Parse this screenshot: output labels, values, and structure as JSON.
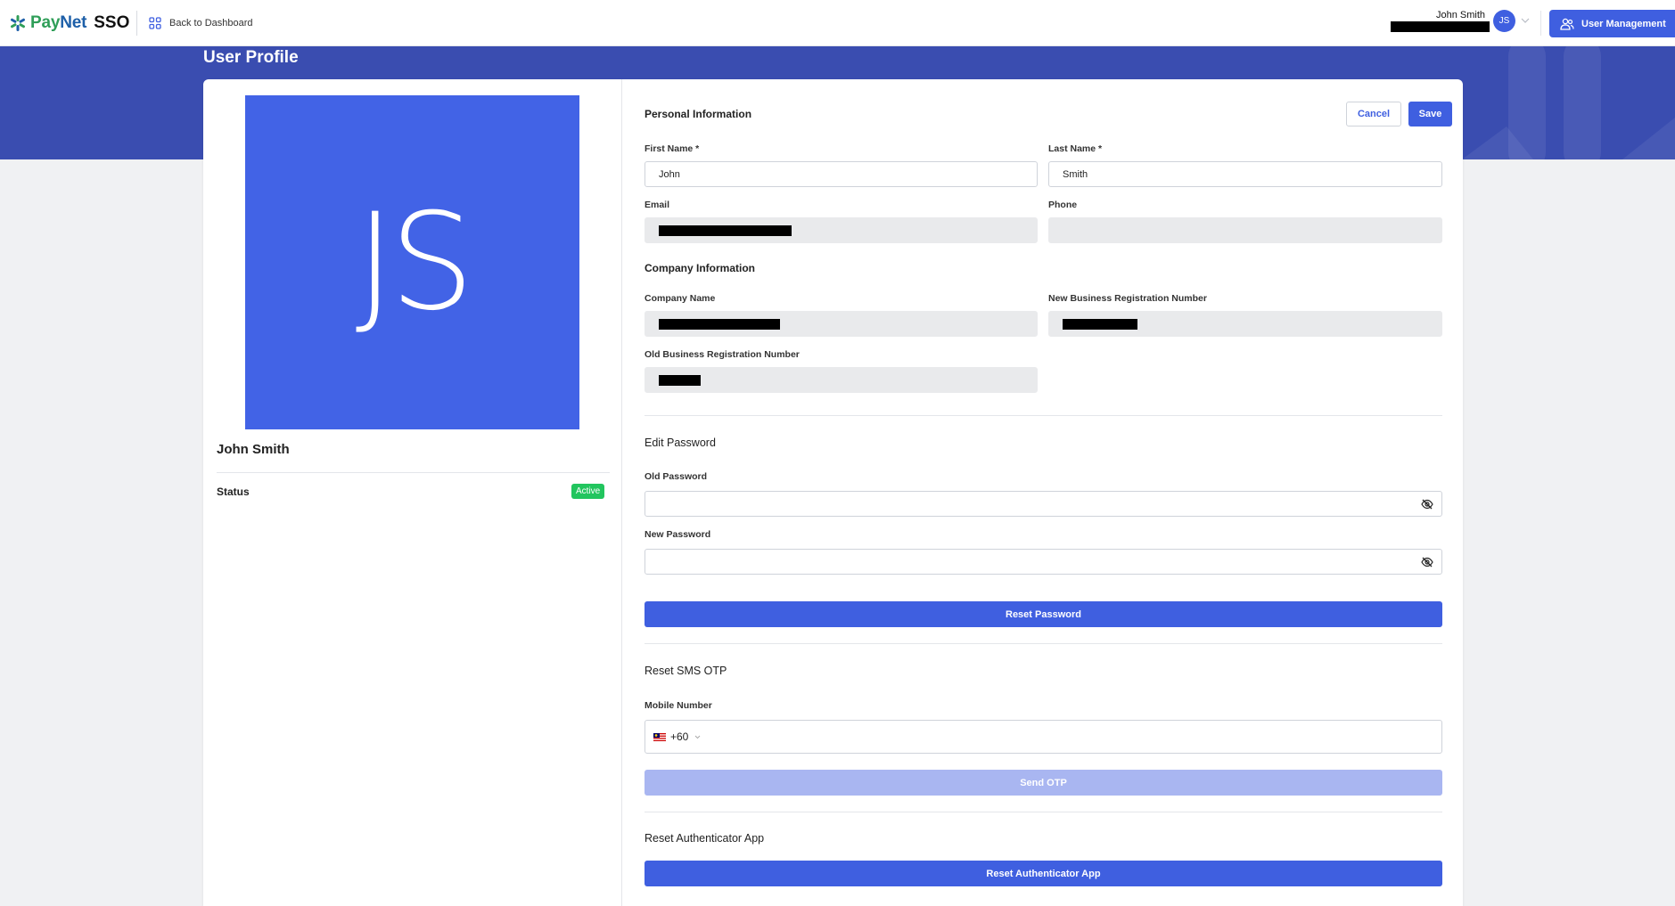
{
  "brand": {
    "name_part1": "Pay",
    "name_part2": "Net",
    "product": "SSO"
  },
  "nav": {
    "back_label": "Back to Dashboard"
  },
  "user": {
    "name": "John Smith",
    "initials": "JS"
  },
  "header": {
    "user_management_label": "User Management"
  },
  "page": {
    "title": "User Profile"
  },
  "profile": {
    "name": "John Smith",
    "initials": "JS",
    "status_label": "Status",
    "status_value": "Active"
  },
  "personal": {
    "title": "Personal Information",
    "cancel_label": "Cancel",
    "save_label": "Save",
    "first_name_label": "First Name *",
    "first_name_value": "John",
    "last_name_label": "Last Name *",
    "last_name_value": "Smith",
    "email_label": "Email",
    "phone_label": "Phone"
  },
  "company": {
    "title": "Company Information",
    "company_name_label": "Company Name",
    "new_brn_label": "New Business Registration Number",
    "old_brn_label": "Old Business Registration Number"
  },
  "password": {
    "title": "Edit Password",
    "old_label": "Old Password",
    "new_label": "New Password",
    "reset_label": "Reset Password"
  },
  "sms": {
    "title": "Reset SMS OTP",
    "mobile_label": "Mobile Number",
    "country_code": "+60",
    "send_label": "Send OTP"
  },
  "authenticator": {
    "title": "Reset Authenticator App",
    "reset_label": "Reset Authenticator App"
  },
  "colors": {
    "primary": "#3f5fe0",
    "banner": "#3a4db0",
    "active": "#22c55e"
  }
}
